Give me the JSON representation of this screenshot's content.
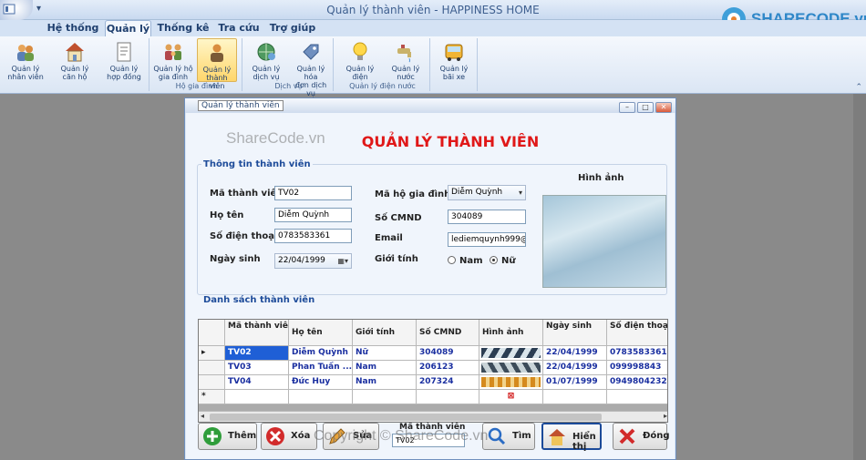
{
  "app": {
    "title": "Quản lý thành viên - HAPPINESS HOME",
    "logo_text": "SHARECODE.vn"
  },
  "ribbon": {
    "tabs": [
      {
        "label": "Hệ thống"
      },
      {
        "label": "Quản lý"
      },
      {
        "label": "Thống kê"
      },
      {
        "label": "Tra cứu"
      },
      {
        "label": "Trợ giúp"
      }
    ],
    "buttons": [
      {
        "line1": "Quản lý",
        "line2": "nhân viên"
      },
      {
        "line1": "Quản lý",
        "line2": "căn hộ"
      },
      {
        "line1": "Quản lý",
        "line2": "hợp đồng"
      },
      {
        "line1": "Quản lý hộ",
        "line2": "gia đình"
      },
      {
        "line1": "Quản lý",
        "line2": "thành viên"
      },
      {
        "line1": "Quản lý",
        "line2": "dịch vụ"
      },
      {
        "line1": "Quản lý hóa",
        "line2": "đơn dịch vụ"
      },
      {
        "line1": "Quản lý điện",
        "line2": ""
      },
      {
        "line1": "Quản lý nước",
        "line2": ""
      },
      {
        "line1": "Quản lý",
        "line2": "bãi xe"
      }
    ],
    "groups": {
      "hgd": "Hộ gia đình",
      "dv": "Dịch vụ",
      "dn": "Quản lý điện nước"
    }
  },
  "window": {
    "tab_title": "Quản lý thành viên",
    "heading": "QUẢN LÝ THÀNH VIÊN",
    "watermark": "ShareCode.vn"
  },
  "info": {
    "legend": "Thông tin thành viên",
    "ma_tv_label": "Mã thành viên",
    "ma_tv_value": "TV02",
    "ho_ten_label": "Họ tên",
    "ho_ten_value": "Diễm Quỳnh",
    "sdt_label": "Số điện thoại",
    "sdt_value": "0783583361",
    "ngay_sinh_label": "Ngày sinh",
    "ngay_sinh_value": "22/04/1999",
    "ma_hgd_label": "Mã hộ gia đình",
    "ma_hgd_value": "Diễm Quỳnh",
    "cmnd_label": "Số CMND",
    "cmnd_value": "304089",
    "email_label": "Email",
    "email_value": "lediemquynh999@",
    "gioi_tinh_label": "Giới tính",
    "nam": "Nam",
    "nu": "Nữ",
    "hinh_anh_label": "Hình ảnh"
  },
  "list": {
    "legend": "Danh sách thành viên",
    "columns": [
      "Mã thành viên",
      "Họ tên",
      "Giới tính",
      "Số CMND",
      "Hình ảnh",
      "Ngày sinh",
      "Số điện thoại"
    ],
    "rows": [
      {
        "ma": "TV02",
        "ten": "Diễm Quỳnh",
        "gt": "Nữ",
        "cmnd": "304089",
        "ns": "22/04/1999",
        "sdt": "0783583361"
      },
      {
        "ma": "TV03",
        "ten": "Phan Tuấn ...",
        "gt": "Nam",
        "cmnd": "206123",
        "ns": "22/04/1999",
        "sdt": "099998843"
      },
      {
        "ma": "TV04",
        "ten": "Đức Huy",
        "gt": "Nam",
        "cmnd": "207324",
        "ns": "01/07/1999",
        "sdt": "0949804232"
      }
    ],
    "new_row_marker": "*"
  },
  "actions": {
    "them": "Thêm",
    "xoa": "Xóa",
    "sua": "Sửa",
    "ma_tv_search_label": "Mã thành viên",
    "ma_tv_search_value": "TV02",
    "tim": "Tìm",
    "hien_thi": "Hiển thị",
    "dong": "Đóng",
    "copyright": "Copyright © ShareCode.vn"
  }
}
